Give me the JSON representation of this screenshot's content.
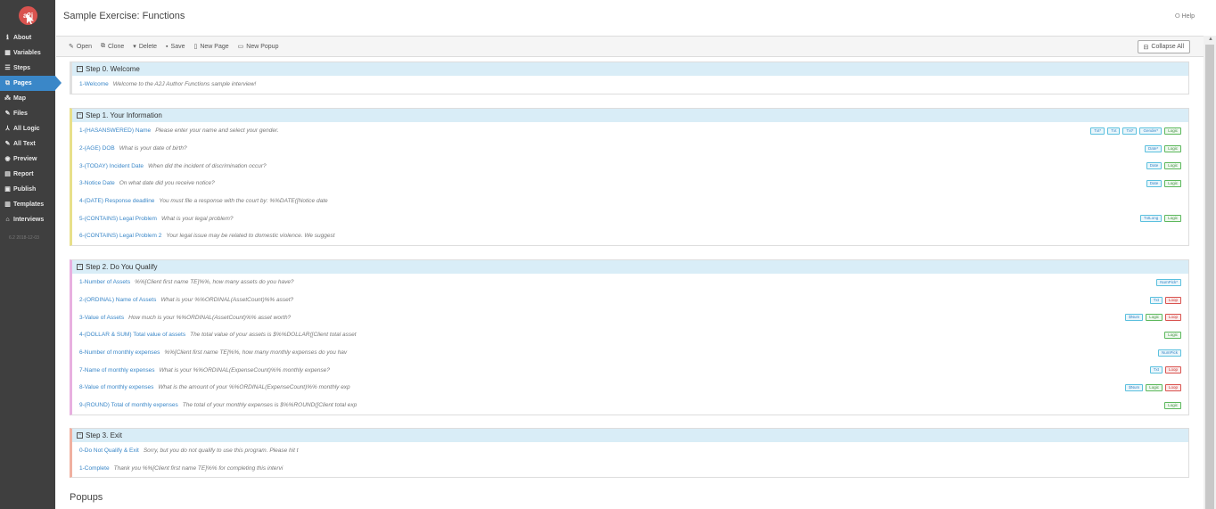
{
  "app": {
    "logo": "a2j"
  },
  "header": {
    "title": "Sample Exercise: Functions",
    "help": "Help"
  },
  "sidebar": {
    "items": [
      {
        "label": "About",
        "icon": "info-icon"
      },
      {
        "label": "Variables",
        "icon": "variables-icon"
      },
      {
        "label": "Steps",
        "icon": "steps-icon"
      },
      {
        "label": "Pages",
        "icon": "pages-icon"
      },
      {
        "label": "Map",
        "icon": "map-icon"
      },
      {
        "label": "Files",
        "icon": "files-icon"
      },
      {
        "label": "All Logic",
        "icon": "logic-icon"
      },
      {
        "label": "All Text",
        "icon": "text-icon"
      },
      {
        "label": "Preview",
        "icon": "eye-icon"
      },
      {
        "label": "Report",
        "icon": "report-icon"
      },
      {
        "label": "Publish",
        "icon": "publish-icon"
      },
      {
        "label": "Templates",
        "icon": "templates-icon"
      },
      {
        "label": "Interviews",
        "icon": "home-icon"
      }
    ],
    "active": "Pages",
    "version": "6.2 2018-12-03"
  },
  "toolbar": {
    "open": "Open",
    "clone": "Clone",
    "delete": "Delete",
    "save": "Save",
    "new_page": "New Page",
    "new_popup": "New Popup",
    "collapse_all": "Collapse All"
  },
  "steps": [
    {
      "title": "Step 0. Welcome",
      "color": "#e0e0e0",
      "pages": [
        {
          "name": "1-Welcome",
          "text": "Welcome to the A2J Author Functions sample interview!",
          "tags": []
        }
      ]
    },
    {
      "title": "Step 1. Your Information",
      "color": "#e8e08a",
      "pages": [
        {
          "name": "1-(HASANSWERED) Name",
          "text": "Please enter your name and select your gender.",
          "tags": [
            [
              "Txt*",
              "blue"
            ],
            [
              "Txt",
              "blue"
            ],
            [
              "Txt*",
              "blue"
            ],
            [
              "Gender*",
              "blue"
            ],
            [
              "Logic",
              "green"
            ]
          ]
        },
        {
          "name": "2-(AGE) DOB",
          "text": "What is your date of birth?",
          "tags": [
            [
              "Date*",
              "blue"
            ],
            [
              "Logic",
              "green"
            ]
          ]
        },
        {
          "name": "3-(TODAY) Incident Date",
          "text": "When did the incident of discrimination occur?",
          "tags": [
            [
              "Date",
              "blue"
            ],
            [
              "Logic",
              "green"
            ]
          ]
        },
        {
          "name": "3-Notice Date",
          "text": "On what date did you receive notice?",
          "tags": [
            [
              "Date",
              "blue"
            ],
            [
              "Logic",
              "green"
            ]
          ]
        },
        {
          "name": "4-(DATE) Response deadline",
          "text": "You must file a response with the court by: %%DATE([Notice date",
          "tags": []
        },
        {
          "name": "5-(CONTAINS) Legal Problem",
          "text": "What is your legal problem?",
          "tags": [
            [
              "TxtLong",
              "blue"
            ],
            [
              "Logic",
              "green"
            ]
          ]
        },
        {
          "name": "6-(CONTAINS) Legal Problem 2",
          "text": "Your legal issue may be related to domestic violence. We suggest",
          "tags": []
        }
      ]
    },
    {
      "title": "Step 2. Do You Qualify",
      "color": "#e8b0e0",
      "pages": [
        {
          "name": "1-Number of Assets",
          "text": "%%[Client first name TE]%%, how many assets do you have?",
          "tags": [
            [
              "NumPick*",
              "blue"
            ]
          ]
        },
        {
          "name": "2-(ORDINAL) Name of Assets",
          "text": "What is your %%ORDINAL(AssetCount)%% asset?",
          "tags": [
            [
              "Txt",
              "blue"
            ],
            [
              "Loop",
              "red"
            ]
          ]
        },
        {
          "name": "3-Value of Assets",
          "text": "How much is your %%ORDINAL(AssetCount)%% asset worth?",
          "tags": [
            [
              "$Num",
              "blue"
            ],
            [
              "Logic",
              "green"
            ],
            [
              "Loop",
              "red"
            ]
          ]
        },
        {
          "name": "4-(DOLLAR & SUM) Total value of assets",
          "text": "The total value of your assets is $%%DOLLAR([Client total asset",
          "tags": [
            [
              "Logic",
              "green"
            ]
          ]
        },
        {
          "name": "6-Number of monthly expenses",
          "text": "%%[Client first name TE]%%, how many monthly expenses do you hav",
          "tags": [
            [
              "NumPick",
              "blue"
            ]
          ]
        },
        {
          "name": "7-Name of monthly expenses",
          "text": "What is your %%ORDINAL(ExpenseCount)%% monthly expense?",
          "tags": [
            [
              "Txt",
              "blue"
            ],
            [
              "Loop",
              "red"
            ]
          ]
        },
        {
          "name": "8-Value of monthly expenses",
          "text": "What is the amount of your %%ORDINAL(ExpenseCount)%% monthly exp",
          "tags": [
            [
              "$Num",
              "blue"
            ],
            [
              "Logic",
              "green"
            ],
            [
              "Loop",
              "red"
            ]
          ]
        },
        {
          "name": "9-(ROUND) Total of monthly expenses",
          "text": "The total of your monthly expenses is $%%ROUND([Client total exp",
          "tags": [
            [
              "Logic",
              "green"
            ]
          ]
        }
      ]
    },
    {
      "title": "Step 3. Exit",
      "color": "#f0b0a0",
      "pages": [
        {
          "name": "0-Do Not Qualify & Exit",
          "text": "Sorry, but you do not qualify to use this program. Please hit t",
          "tags": []
        },
        {
          "name": "1-Complete",
          "text": "Thank you %%[Client first name TE]%% for completing this intervi",
          "tags": []
        }
      ]
    }
  ],
  "popups_heading": "Popups"
}
